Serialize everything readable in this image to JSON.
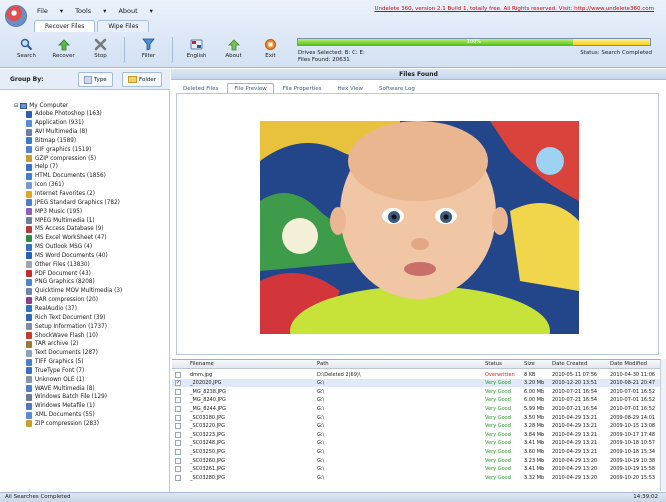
{
  "menu": [
    "File",
    "Tools",
    "About"
  ],
  "top_tabs": [
    "Recover Files",
    "Wipe Files"
  ],
  "toolbar": [
    {
      "label": "Search",
      "icon": "magnifier-icon"
    },
    {
      "label": "Recover",
      "icon": "recover-arrow-icon"
    },
    {
      "label": "Stop",
      "icon": "stop-x-icon"
    },
    {
      "label": "Filter",
      "icon": "filter-funnel-icon"
    },
    {
      "label": "English",
      "icon": "language-icon"
    },
    {
      "label": "About",
      "icon": "about-icon"
    },
    {
      "label": "Exit",
      "icon": "exit-icon"
    }
  ],
  "registration": "Undelete 360, version 2.1 Build 1, totally free. All Rights reserved. Visit: http://www.undelete360.com",
  "progress": {
    "percent_label": "100%",
    "value": 1.0
  },
  "drives_selected": "Drives Selected: B: C: E:",
  "files_found_count": "Files Found: 20631",
  "status_text": "Status: Search Completed",
  "group_by": {
    "label": "Group By:",
    "buttons": [
      "Type",
      "Folder"
    ]
  },
  "tree": {
    "root": "My Computer",
    "items": [
      {
        "label": "Adobe Photoshop (163)",
        "color": "#2a5db0"
      },
      {
        "label": "Application (931)",
        "color": "#5b8bd1"
      },
      {
        "label": "AVI Multimedia (8)",
        "color": "#6c7fa8"
      },
      {
        "label": "Bitmap (1589)",
        "color": "#3d78c9"
      },
      {
        "label": "GIF graphics (1519)",
        "color": "#4f82d0"
      },
      {
        "label": "GZIP compression (5)",
        "color": "#c79b2c"
      },
      {
        "label": "Help (7)",
        "color": "#3b6fc2"
      },
      {
        "label": "HTML Documents (1856)",
        "color": "#3f80d5"
      },
      {
        "label": "Icon (361)",
        "color": "#7b9bd0"
      },
      {
        "label": "Internet Favorites (2)",
        "color": "#e3a51c"
      },
      {
        "label": "JPEG Standard Graphics (782)",
        "color": "#4d7bc4"
      },
      {
        "label": "MP3 Music (195)",
        "color": "#8c5fb8"
      },
      {
        "label": "MPEG Multimedia (1)",
        "color": "#6b7fa7"
      },
      {
        "label": "MS Access Database (9)",
        "color": "#b53a3a"
      },
      {
        "label": "MS Excel WorkSheet (47)",
        "color": "#2e8b43"
      },
      {
        "label": "MS Outlook MSG (4)",
        "color": "#3a6fc0"
      },
      {
        "label": "MS Word Documents (40)",
        "color": "#2b5fb5"
      },
      {
        "label": "Other Files (13830)",
        "color": "#9aa4b2"
      },
      {
        "label": "PDF Document (43)",
        "color": "#c62a2a"
      },
      {
        "label": "PNG Graphics (8208)",
        "color": "#4c86d0"
      },
      {
        "label": "Quicktime MOV Multimedia (3)",
        "color": "#6f85ab"
      },
      {
        "label": "RAR compression (20)",
        "color": "#8d3f8f"
      },
      {
        "label": "RealAudio (37)",
        "color": "#2f74c4"
      },
      {
        "label": "Rich Text Document (39)",
        "color": "#3466b8"
      },
      {
        "label": "Setup Information (1737)",
        "color": "#7d8fa8"
      },
      {
        "label": "ShockWave Flash (10)",
        "color": "#c23b2b"
      },
      {
        "label": "TAR archive (2)",
        "color": "#9c7a35"
      },
      {
        "label": "Text Documents (287)",
        "color": "#8fa2bd"
      },
      {
        "label": "TIFF Graphics (5)",
        "color": "#4a7fc9"
      },
      {
        "label": "TrueType Font (7)",
        "color": "#3a6fc2"
      },
      {
        "label": "Unknown OLE (1)",
        "color": "#8a96a8"
      },
      {
        "label": "WAVE Multimedia (8)",
        "color": "#4f7fc5"
      },
      {
        "label": "Windows Batch File (129)",
        "color": "#6d7b90"
      },
      {
        "label": "Windows Metafile (1)",
        "color": "#4d7ac0"
      },
      {
        "label": "XML Documents (55)",
        "color": "#5c8bcf"
      },
      {
        "label": "ZIP compression (283)",
        "color": "#c7a12c"
      }
    ]
  },
  "files_found_title": "Files Found",
  "preview_tabs": [
    "Deleted Files",
    "File Preview",
    "File Properties",
    "Hex View",
    "Software Log"
  ],
  "grid": {
    "columns": [
      "Filename",
      "Path",
      "Status",
      "Size",
      "Date Created",
      "Date Modified"
    ],
    "rows": [
      {
        "name": "dmm.jpg",
        "path": "D:\\Deleted 2(69)\\",
        "status": "Overwritten",
        "size": "8 KB",
        "created": "2010-05-11 07:56",
        "modified": "2010-04-30 11:06",
        "checked": false,
        "selected": false
      },
      {
        "name": "_202020.JPG",
        "path": "G:\\",
        "status": "Very Good",
        "size": "3.20 Mb",
        "created": "2010-12-20 13:51",
        "modified": "2010-08-21 20:47",
        "checked": true,
        "selected": true
      },
      {
        "name": "_MG_8238.JPG",
        "path": "G:\\",
        "status": "Very Good",
        "size": "6.00 Mb",
        "created": "2010-07-21 16:54",
        "modified": "2010-07-01 16:52",
        "checked": false,
        "selected": false
      },
      {
        "name": "_MG_8240.JPG",
        "path": "G:\\",
        "status": "Very Good",
        "size": "6.00 Mb",
        "created": "2010-07-21 16:54",
        "modified": "2010-07-01 16:52",
        "checked": false,
        "selected": false
      },
      {
        "name": "_MG_8244.JPG",
        "path": "G:\\",
        "status": "Very Good",
        "size": "5.99 Mb",
        "created": "2010-07-21 16:54",
        "modified": "2010-07-01 16:52",
        "checked": false,
        "selected": false
      },
      {
        "name": "_SC03180.JPG",
        "path": "G:\\",
        "status": "Very Good",
        "size": "3.50 Mb",
        "created": "2010-04-29 13:21",
        "modified": "2009-08-29 14:01",
        "checked": false,
        "selected": false
      },
      {
        "name": "_SC03220.JPG",
        "path": "G:\\",
        "status": "Very Good",
        "size": "3.28 Mb",
        "created": "2010-04-29 13:21",
        "modified": "2009-10-15 13:08",
        "checked": false,
        "selected": false
      },
      {
        "name": "_SC03223.JPG",
        "path": "G:\\",
        "status": "Very Good",
        "size": "3.84 Mb",
        "created": "2010-04-29 13:21",
        "modified": "2009-10-17 17:48",
        "checked": false,
        "selected": false
      },
      {
        "name": "_SC03248.JPG",
        "path": "G:\\",
        "status": "Very Good",
        "size": "3.41 Mb",
        "created": "2010-04-29 13:21",
        "modified": "2009-10-18 10:57",
        "checked": false,
        "selected": false
      },
      {
        "name": "_SC03250.JPG",
        "path": "G:\\",
        "status": "Very Good",
        "size": "3.60 Mb",
        "created": "2010-04-29 13:21",
        "modified": "2009-10-18 15:34",
        "checked": false,
        "selected": false
      },
      {
        "name": "_SC03260.JPG",
        "path": "G:\\",
        "status": "Very Good",
        "size": "3.23 Mb",
        "created": "2010-04-29 13:20",
        "modified": "2009-10-19 10:38",
        "checked": false,
        "selected": false
      },
      {
        "name": "_SC03261.JPG",
        "path": "G:\\",
        "status": "Very Good",
        "size": "3.41 Mb",
        "created": "2010-04-29 13:20",
        "modified": "2009-10-19 15:58",
        "checked": false,
        "selected": false
      },
      {
        "name": "_SC03280.JPG",
        "path": "G:\\",
        "status": "Very Good",
        "size": "3.32 Mb",
        "created": "2010-04-29 13:20",
        "modified": "2009-10-20 15:53",
        "checked": false,
        "selected": false
      }
    ]
  },
  "statusbar": {
    "left": "All Searches Completed",
    "right": "14:39:02"
  }
}
